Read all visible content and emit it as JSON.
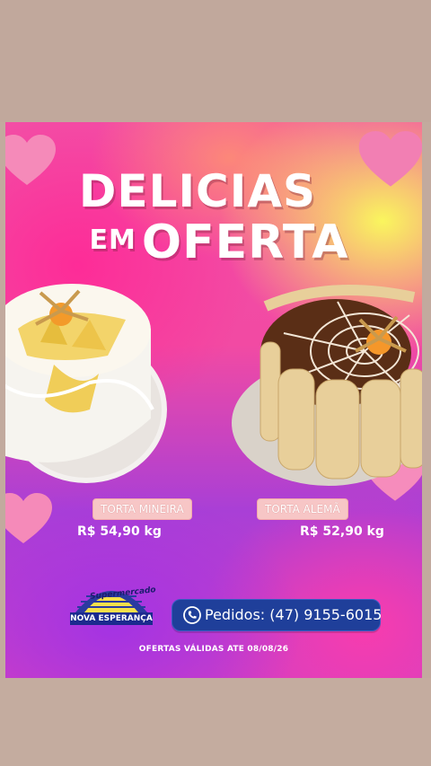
{
  "flyer": {
    "title_line1": "DELICIAS",
    "title_line2_small": "EM",
    "title_line2_big": "OFERTA",
    "products": [
      {
        "name": "TORTA MINEIRA",
        "price": "R$ 54,90 kg"
      },
      {
        "name": "TORTA ALEMÃ",
        "price": "R$ 52,90 kg"
      }
    ],
    "logo": {
      "line1": "Supermercado",
      "line2": "NOVA ESPERANÇA"
    },
    "order": {
      "text": "Pedidos: (47) 9155-6015",
      "icon": "phone-icon"
    },
    "validity": "OFERTAS VÁLIDAS ATE 08/08/26"
  },
  "colors": {
    "pink": "#f24fa6",
    "yellow": "#f7ff5a",
    "purple": "#a93fd6",
    "order_button": "#1f3f9a",
    "label_bg": "#f7c6c6"
  }
}
